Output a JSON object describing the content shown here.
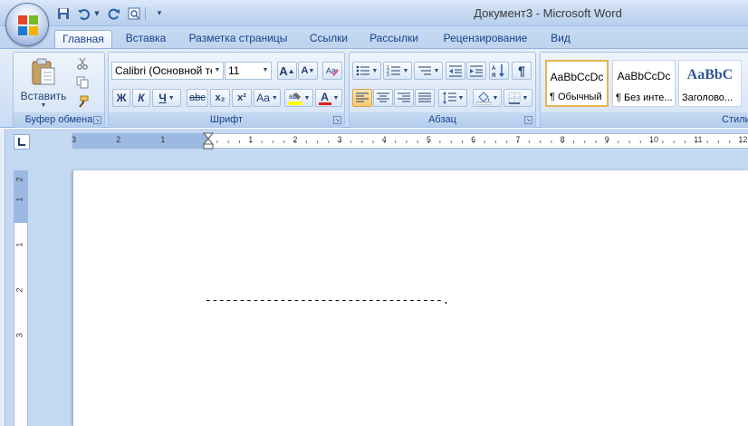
{
  "window": {
    "title": "Документ3 - Microsoft Word"
  },
  "quick_access": {
    "icons": [
      "save-icon",
      "undo-icon",
      "redo-icon",
      "print-preview-icon",
      "customize-qat-icon"
    ]
  },
  "tabs": [
    "Главная",
    "Вставка",
    "Разметка страницы",
    "Ссылки",
    "Рассылки",
    "Рецензирование",
    "Вид"
  ],
  "active_tab": "Главная",
  "ribbon": {
    "clipboard": {
      "label": "Буфер обмена",
      "paste_label": "Вставить"
    },
    "font": {
      "label": "Шрифт",
      "font_name": "Calibri (Основной те",
      "font_size": "11",
      "bold": "Ж",
      "italic": "К",
      "underline": "Ч",
      "strike": "abc",
      "subscript": "x₂",
      "superscript": "x²",
      "change_case": "Aa",
      "grow": "A",
      "shrink": "A",
      "font_color_letter": "A"
    },
    "paragraph": {
      "label": "Абзац",
      "pilcrow": "¶"
    },
    "styles": {
      "label": "Стили",
      "items": [
        {
          "preview": "AaBbCcDc",
          "name": "¶ Обычный"
        },
        {
          "preview": "AaBbCcDc",
          "name": "¶ Без инте..."
        },
        {
          "preview": "AaBbC",
          "name": "Заголово..."
        }
      ]
    }
  },
  "ruler": {
    "horizontal_labels": [
      "3",
      "2",
      "1",
      "1",
      "2",
      "3",
      "4",
      "5",
      "6",
      "7",
      "8",
      "9",
      "10",
      "11",
      "12"
    ],
    "vertical_labels": [
      "2",
      "1",
      "1",
      "2",
      "3"
    ]
  },
  "document": {
    "content": "-----------------------------------."
  },
  "colors": {
    "ribbon_bg": "#d6e4f6",
    "accent_text": "#15428b",
    "highlight": "#ffff00",
    "font_color": "#e02020"
  }
}
